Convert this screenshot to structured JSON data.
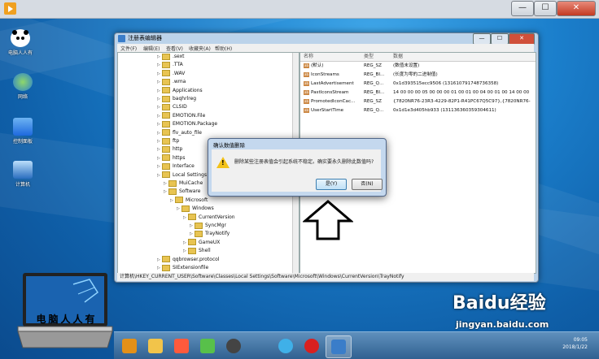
{
  "desktop": {
    "icons": [
      {
        "label": "电脑人人有"
      },
      {
        "label": "网络"
      },
      {
        "label": "控制面板"
      },
      {
        "label": "计算机"
      }
    ]
  },
  "outer_window": {
    "min_label": "—",
    "max_label": "☐",
    "close_label": "✕"
  },
  "regedit": {
    "title": "注册表编辑器",
    "menus": [
      "文件(F)",
      "编辑(E)",
      "查看(V)",
      "收藏夹(A)",
      "帮助(H)"
    ],
    "tree": [
      {
        "label": ".sext",
        "indent": 0
      },
      {
        "label": ".TTA",
        "indent": 0
      },
      {
        "label": ".WAV",
        "indent": 0
      },
      {
        "label": ".wma",
        "indent": 0
      },
      {
        "label": "Applications",
        "indent": 0
      },
      {
        "label": "baqhrlreg",
        "indent": 0
      },
      {
        "label": "CLSID",
        "indent": 0
      },
      {
        "label": "EMOTION.File",
        "indent": 0
      },
      {
        "label": "EMOTION.Package",
        "indent": 0
      },
      {
        "label": "flv_auto_file",
        "indent": 0
      },
      {
        "label": "ftp",
        "indent": 0
      },
      {
        "label": "http",
        "indent": 0
      },
      {
        "label": "https",
        "indent": 0
      },
      {
        "label": "Interface",
        "indent": 0
      },
      {
        "label": "Local Settings",
        "indent": 0
      },
      {
        "label": "MuiCache",
        "indent": 1
      },
      {
        "label": "Software",
        "indent": 1
      },
      {
        "label": "Microsoft",
        "indent": 2
      },
      {
        "label": "Windows",
        "indent": 3
      },
      {
        "label": "CurrentVersion",
        "indent": 4
      },
      {
        "label": "SyncMgr",
        "indent": 5
      },
      {
        "label": "TrayNotify",
        "indent": 5
      },
      {
        "label": "GameUX",
        "indent": 4
      },
      {
        "label": "Shell",
        "indent": 4
      },
      {
        "label": "qqbrowser.protocol",
        "indent": 0
      },
      {
        "label": "SIExtensionfile",
        "indent": 0
      }
    ],
    "columns": {
      "name": "名称",
      "type": "类型",
      "data": "数据"
    },
    "rows": [
      {
        "name": "(默认)",
        "type": "REG_SZ",
        "data": "(数值未设置)"
      },
      {
        "name": "IconStreams",
        "type": "REG_BI...",
        "data": "(长度为零的二进制值)"
      },
      {
        "name": "LastAdvertisement",
        "type": "REG_Q...",
        "data": "0x1d393515ecc9506 (131610791748736358)"
      },
      {
        "name": "PastIconsStream",
        "type": "REG_BI...",
        "data": "14 00 00 00 05 00 00 00 01 00 01 00 04 00 01 00 14 00 00"
      },
      {
        "name": "PromotedIconCac...",
        "type": "REG_SZ",
        "data": "{7820NR76-23R3-4229-82P1-R41PC67Q5C97},{7820NR76-"
      },
      {
        "name": "UserStartTime",
        "type": "REG_Q...",
        "data": "0x1d1e3d405hb933 (131136360359304611)"
      }
    ],
    "status_path": "计算机\\HKEY_CURRENT_USER\\Software\\Classes\\Local Settings\\Software\\Microsoft\\Windows\\CurrentVersion\\TrayNotify"
  },
  "dialog": {
    "title": "确认数值删除",
    "message": "删除某些注册表值会引起系统不稳定。确实要永久删除此数值吗?",
    "yes_label": "是(Y)",
    "no_label": "否(N)"
  },
  "logo_text": "电脑人人有",
  "taskbar": {
    "clock_time": "09:05",
    "clock_date": "2018/1/22"
  },
  "watermark": {
    "brand": "Baidu经验",
    "url": "jingyan.baidu.com"
  }
}
